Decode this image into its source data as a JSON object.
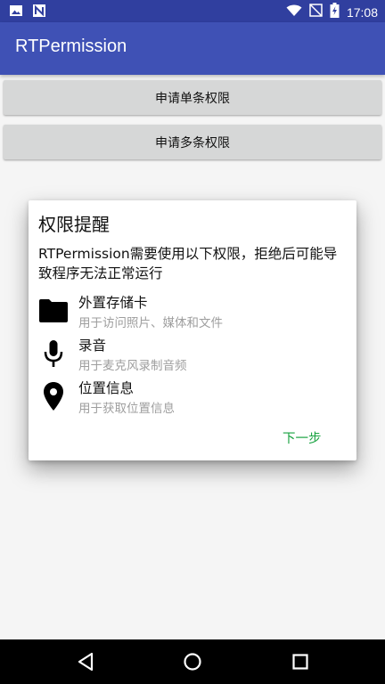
{
  "status_bar": {
    "time": "17:08",
    "icons": [
      "image-icon",
      "n-notification-icon",
      "wifi-icon",
      "signal-off-icon",
      "battery-charging-icon"
    ]
  },
  "app_bar": {
    "title": "RTPermission"
  },
  "buttons": {
    "single": "申请单条权限",
    "multiple": "申请多条权限"
  },
  "dialog": {
    "title": "权限提醒",
    "message": "RTPermission需要使用以下权限，拒绝后可能导致程序无法正常运行",
    "permissions": [
      {
        "icon": "folder-icon",
        "name": "外置存储卡",
        "desc": "用于访问照片、媒体和文件"
      },
      {
        "icon": "microphone-icon",
        "name": "录音",
        "desc": "用于麦克风录制音频"
      },
      {
        "icon": "location-pin-icon",
        "name": "位置信息",
        "desc": "用于获取位置信息"
      }
    ],
    "next_label": "下一步"
  },
  "colors": {
    "status_bar": "#303f9f",
    "app_bar": "#3f51b5",
    "accent_green": "#1aa342",
    "desc_gray": "#9e9e9e"
  }
}
